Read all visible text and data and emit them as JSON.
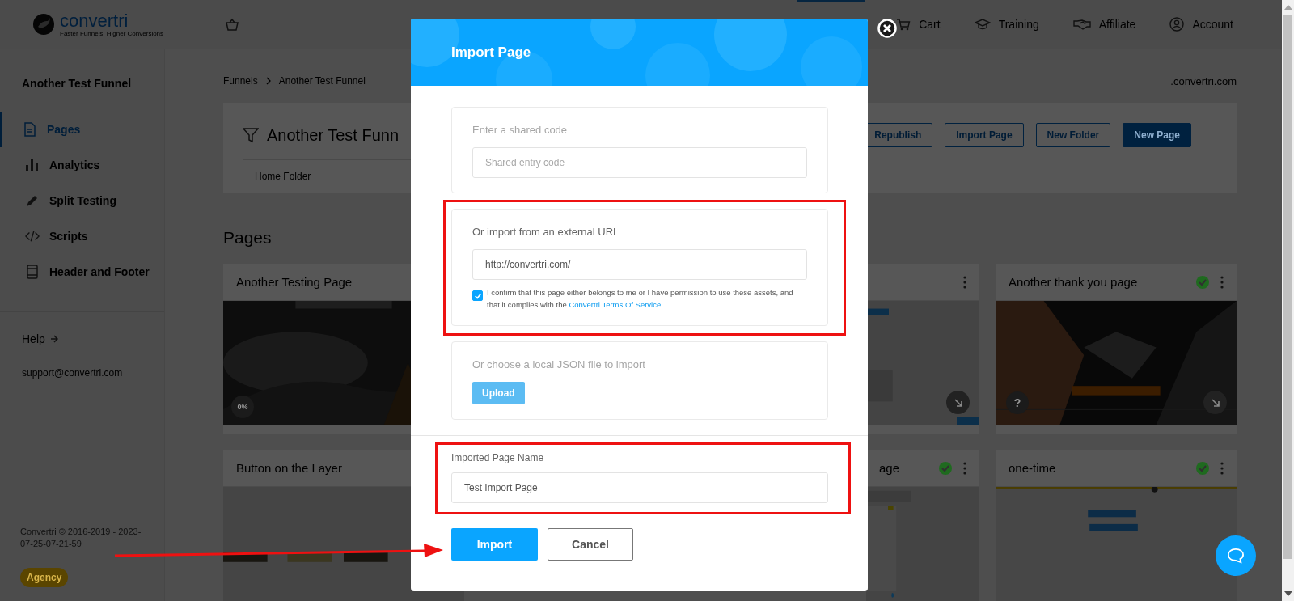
{
  "header": {
    "logo": {
      "name": "convertri",
      "tagline": "Faster Funnels, Higher Conversions"
    },
    "nav": [
      {
        "label": "Cart"
      },
      {
        "label": "Training"
      },
      {
        "label": "Affiliate"
      },
      {
        "label": "Account"
      }
    ]
  },
  "sidebar": {
    "title": "Another Test Funnel",
    "items": [
      {
        "label": "Pages",
        "selected": true
      },
      {
        "label": "Analytics",
        "selected": false
      },
      {
        "label": "Split Testing",
        "selected": false
      },
      {
        "label": "Scripts",
        "selected": false
      },
      {
        "label": "Header and Footer",
        "selected": false
      }
    ],
    "help": "Help",
    "support": "support@convertri.com",
    "copyright": "Convertri © 2016-2019 - 2023-07-25-07-21-59",
    "plan_badge": "Agency"
  },
  "breadcrumb": [
    "Funnels",
    "Another Test Funnel"
  ],
  "domain": ".convertri.com",
  "funnel": {
    "title": "Another Test Funn",
    "folder": "Home Folder",
    "actions": [
      {
        "label": "Republish",
        "primary": false
      },
      {
        "label": "Import Page",
        "primary": false
      },
      {
        "label": "New Folder",
        "primary": false
      },
      {
        "label": "New Page",
        "primary": true
      }
    ]
  },
  "pages": {
    "heading": "Pages",
    "cards": [
      {
        "title": "Another Testing Page",
        "kind": "dark-photo",
        "progress": "0%"
      },
      {
        "kind": "layout",
        "menu": true,
        "open_button": true
      },
      {
        "title": "Another thank you page",
        "kind": "mountain-photo",
        "published": true,
        "menu": true,
        "help_label": "?",
        "open_button": true
      },
      {
        "title": "Button on the Layer",
        "kind": "buttons"
      },
      {
        "title": "age",
        "kind": "form",
        "published": true,
        "menu": true
      },
      {
        "title": "one-time",
        "kind": "bars",
        "published": true,
        "menu": true
      }
    ]
  },
  "modal": {
    "title": "Import Page",
    "sections": [
      {
        "kind": "code",
        "active": false,
        "label": "Enter a shared code",
        "placeholder": "Shared entry code"
      },
      {
        "kind": "url",
        "active": true,
        "highlighted": true,
        "label": "Or import from an external URL",
        "value": "http://convertri.com/",
        "consent": {
          "checked": true,
          "text": "I confirm that this page either belongs to me or I have permission to use these assets, and that it complies with the ",
          "link": "Convertri Terms Of Service",
          "after": "."
        }
      },
      {
        "kind": "file",
        "active": false,
        "label": "Or choose a local JSON file to import",
        "button": "Upload"
      }
    ],
    "name_field": {
      "label": "Imported Page Name",
      "value": "Test Import Page",
      "highlighted": true
    },
    "buttons": [
      {
        "label": "Import",
        "primary": true,
        "pointed_at": true
      },
      {
        "label": "Cancel",
        "primary": false,
        "pointed_at": false
      }
    ]
  }
}
